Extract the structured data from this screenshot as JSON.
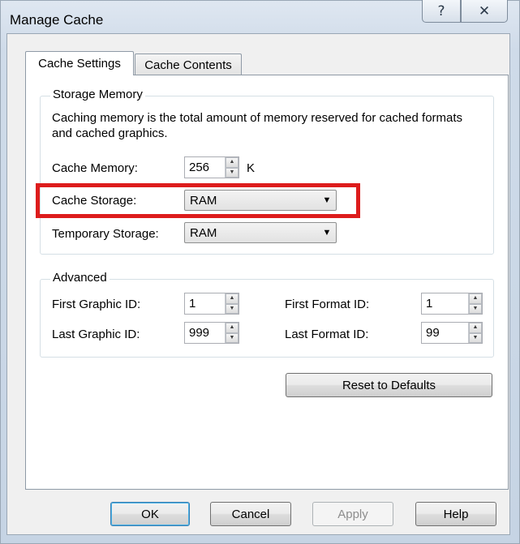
{
  "window": {
    "title": "Manage Cache",
    "help_glyph": "?",
    "close_glyph": "✕"
  },
  "tabs": [
    {
      "label": "Cache Settings",
      "active": true
    },
    {
      "label": "Cache Contents",
      "active": false
    }
  ],
  "storage_memory": {
    "legend": "Storage Memory",
    "description": "Caching memory is the total amount of memory reserved for cached formats and cached graphics.",
    "cache_memory": {
      "label": "Cache Memory:",
      "value": "256",
      "unit": "K"
    },
    "cache_storage": {
      "label": "Cache Storage:",
      "value": "RAM"
    },
    "temporary_storage": {
      "label": "Temporary Storage:",
      "value": "RAM"
    }
  },
  "advanced": {
    "legend": "Advanced",
    "first_graphic_id": {
      "label": "First Graphic ID:",
      "value": "1"
    },
    "last_graphic_id": {
      "label": "Last Graphic ID:",
      "value": "999"
    },
    "first_format_id": {
      "label": "First Format ID:",
      "value": "1"
    },
    "last_format_id": {
      "label": "Last Format ID:",
      "value": "99"
    }
  },
  "reset_button": "Reset to Defaults",
  "footer": {
    "ok": "OK",
    "cancel": "Cancel",
    "apply": "Apply",
    "help": "Help"
  },
  "icons": {
    "spin_up": "▲",
    "spin_down": "▼",
    "dropdown": "▼"
  },
  "colors": {
    "highlight": "#dd1c1c",
    "accent": "#3c7fb1"
  }
}
